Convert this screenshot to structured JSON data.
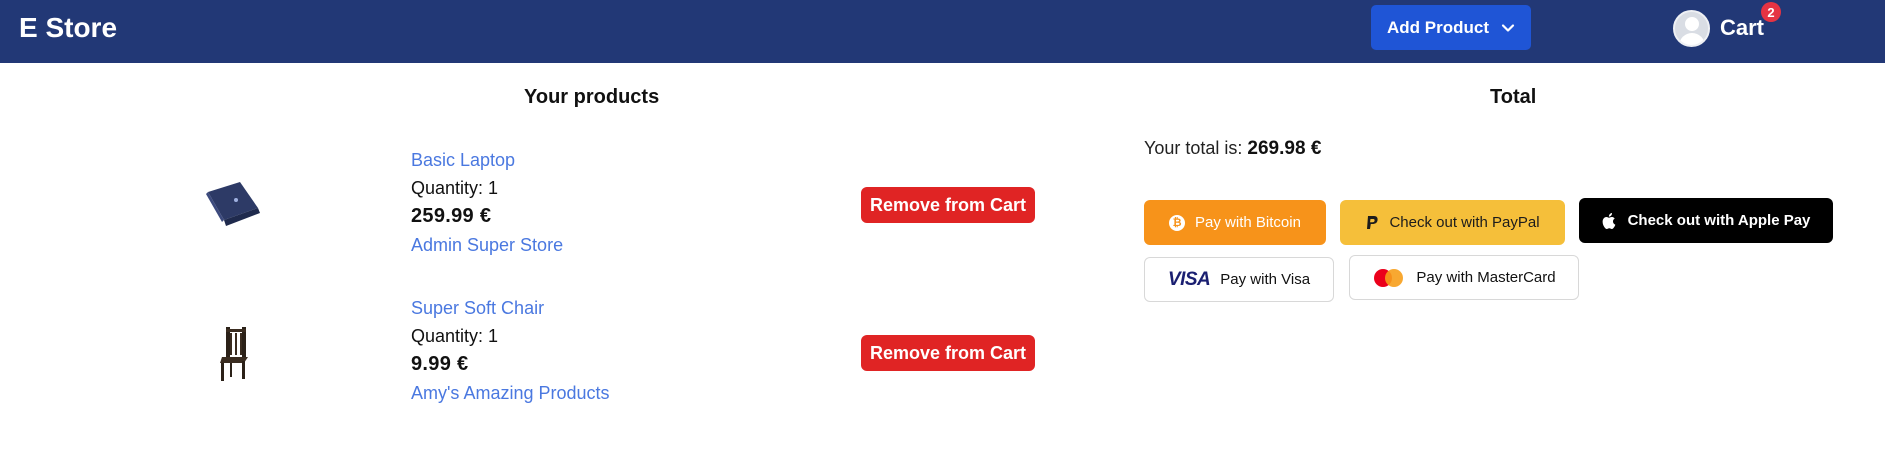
{
  "header": {
    "brand": "E Store",
    "add_product_label": "Add Product",
    "cart_label": "Cart",
    "cart_count": "2",
    "colors": {
      "bar": "#223876",
      "add_button": "#1f55d6",
      "badge": "#e53343"
    }
  },
  "products_section": {
    "title": "Your products",
    "items": [
      {
        "name": "Basic Laptop",
        "quantity": "Quantity: 1",
        "price": "259.99 €",
        "store": "Admin Super Store",
        "remove_label": "Remove from Cart",
        "image_icon": "laptop-icon"
      },
      {
        "name": "Super Soft Chair",
        "quantity": "Quantity: 1",
        "price": "9.99 €",
        "store": "Amy's Amazing Products",
        "remove_label": "Remove from Cart",
        "image_icon": "chair-icon"
      }
    ]
  },
  "total_section": {
    "title": "Total",
    "total_prefix": "Your total is:",
    "total_value": "269.98 €",
    "payments": {
      "bitcoin": "Pay with Bitcoin",
      "paypal": "Check out with PayPal",
      "apple": "Check out with Apple Pay",
      "visa": "Pay with Visa",
      "visa_logo": "VISA",
      "mastercard": "Pay with MasterCard"
    }
  }
}
